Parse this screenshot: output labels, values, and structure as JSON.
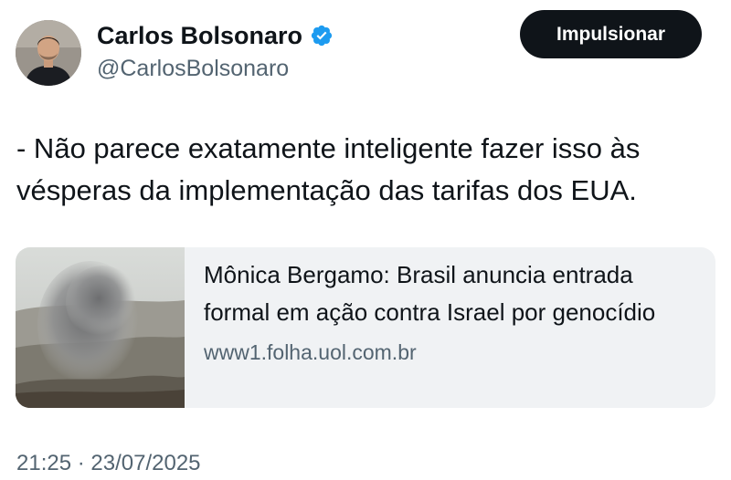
{
  "author": {
    "display_name": "Carlos Bolsonaro",
    "handle": "@CarlosBolsonaro"
  },
  "actions": {
    "promote_label": "Impulsionar"
  },
  "tweet": {
    "text": "- Não parece exatamente inteligente fazer isso às\nvésperas da implementação das tarifas dos EUA."
  },
  "link_card": {
    "title": "Mônica Bergamo: Brasil anuncia entrada formal em ação contra Israel por genocídio",
    "domain": "www1.folha.uol.com.br"
  },
  "meta": {
    "time": "21:25",
    "separator": "·",
    "date": "23/07/2025"
  },
  "colors": {
    "text_primary": "#0f1419",
    "text_secondary": "#536471",
    "verified_blue": "#1d9bf0",
    "button_bg": "#0f1419",
    "card_bg": "#f0f2f4"
  }
}
